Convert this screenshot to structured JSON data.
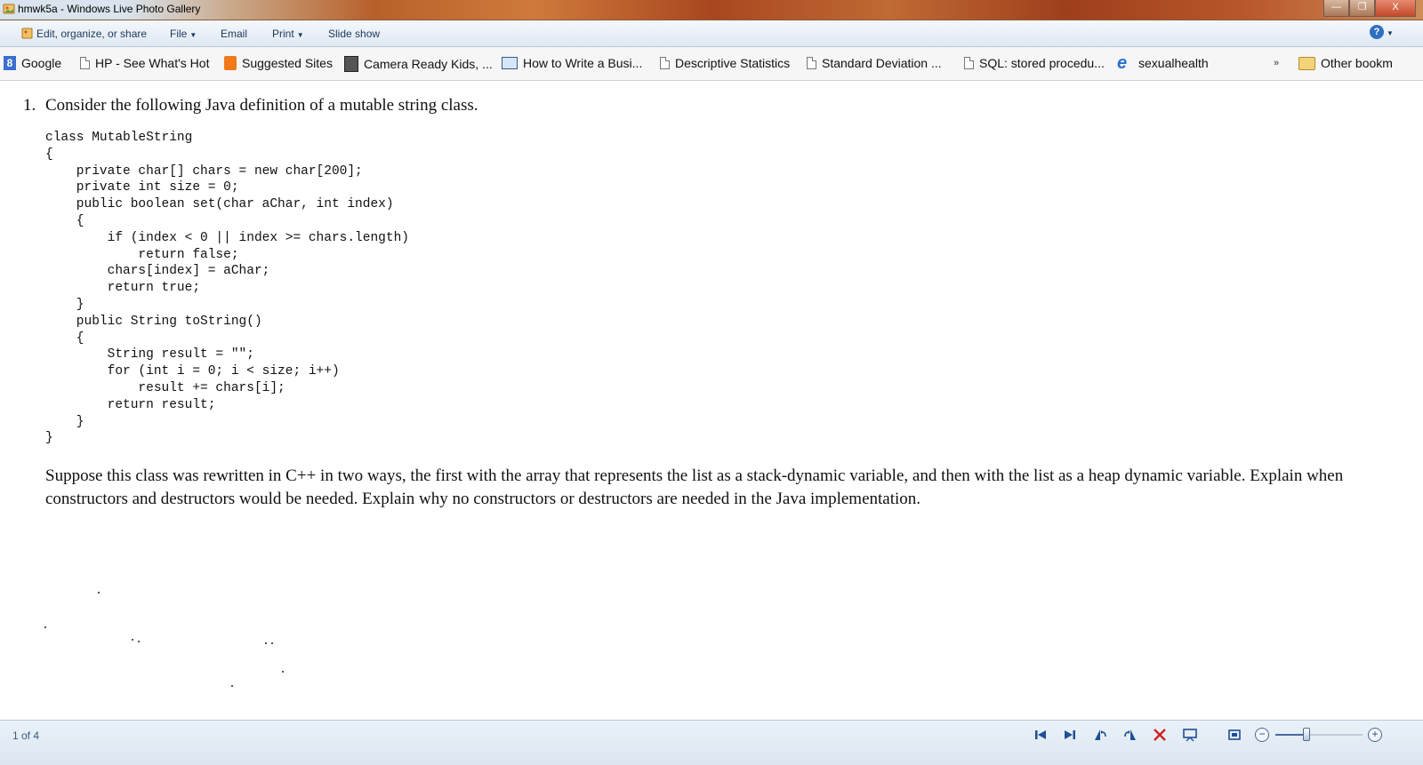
{
  "window": {
    "title": "hmwk5a - Windows Live Photo Gallery",
    "minimize_glyph": "—",
    "maximize_glyph": "❐",
    "close_glyph": "X"
  },
  "toolbar": {
    "edit_label": "Edit, organize, or share",
    "file_label": "File",
    "email_label": "Email",
    "print_label": "Print",
    "slideshow_label": "Slide show",
    "help_glyph": "?"
  },
  "bookmarks": {
    "items": [
      {
        "label": "Google",
        "icon": "google-icon"
      },
      {
        "label": "HP - See What's Hot",
        "icon": "page-icon"
      },
      {
        "label": "Suggested Sites",
        "icon": "suggested-sites-icon"
      },
      {
        "label": "Camera Ready Kids, ...",
        "icon": "camera-icon"
      },
      {
        "label": "How to Write a Busi...",
        "icon": "monitor-icon"
      },
      {
        "label": "Descriptive Statistics",
        "icon": "page-icon"
      },
      {
        "label": "Standard Deviation ...",
        "icon": "page-icon"
      },
      {
        "label": "SQL: stored procedu...",
        "icon": "page-icon"
      },
      {
        "label": "sexualhealth",
        "icon": "ie-icon"
      }
    ],
    "overflow_glyph": "»",
    "other_label": "Other bookm"
  },
  "document": {
    "question_number": "1.",
    "question_text": "Consider the following Java definition of a mutable string class.",
    "code_lines": [
      "class MutableString",
      "{",
      "    private char[] chars = new char[200];",
      "    private int size = 0;",
      "    public boolean set(char aChar, int index)",
      "    {",
      "        if (index < 0 || index >= chars.length)",
      "            return false;",
      "        chars[index] = aChar;",
      "        return true;",
      "    }",
      "    public String toString()",
      "    {",
      "        String result = \"\";",
      "        for (int i = 0; i < size; i++)",
      "            result += chars[i];",
      "        return result;",
      "    }",
      "}"
    ],
    "paragraph_line1": "Suppose this class was rewritten in C++ in two ways, the first with the array that represents the list as a stack-dynamic variable, and then with the list as a heap dynamic variable. Explain when",
    "paragraph_line2": "constructors and destructors would be needed. Explain why no constructors or destructors are needed in the Java implementation."
  },
  "statusbar": {
    "page_count": "1 of 4",
    "zoom_level": 0.35,
    "zoom_minus_glyph": "−",
    "zoom_plus_glyph": "+"
  },
  "colors": {
    "accent": "#1f4f96",
    "delete": "#d02020"
  }
}
